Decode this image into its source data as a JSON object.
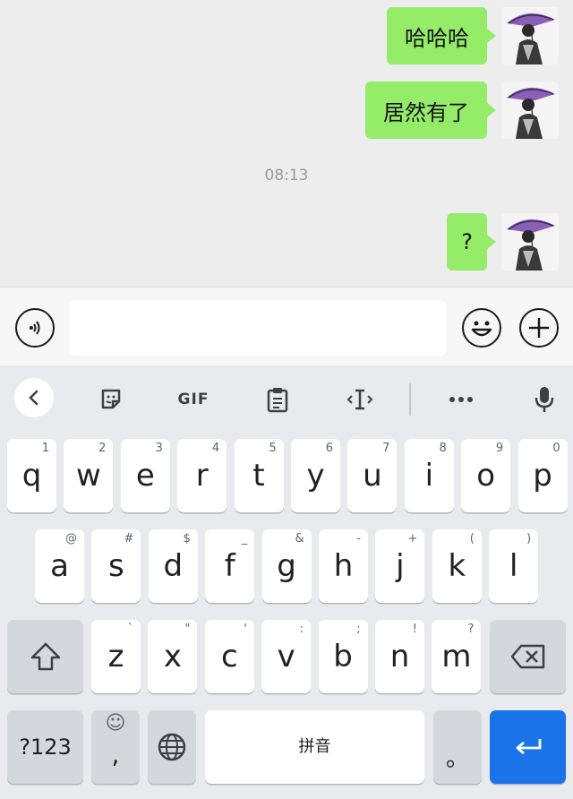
{
  "chat": {
    "messages": [
      {
        "text": "哈哈哈"
      },
      {
        "text": "居然有了"
      },
      {
        "text": "?"
      }
    ],
    "timestamp": "08:13"
  },
  "input": {
    "placeholder": ""
  },
  "keyboard": {
    "toolbar": {
      "gif_label": "GIF"
    },
    "row1": [
      {
        "key": "q",
        "hint": "1"
      },
      {
        "key": "w",
        "hint": "2"
      },
      {
        "key": "e",
        "hint": "3"
      },
      {
        "key": "r",
        "hint": "4"
      },
      {
        "key": "t",
        "hint": "5"
      },
      {
        "key": "y",
        "hint": "6"
      },
      {
        "key": "u",
        "hint": "7"
      },
      {
        "key": "i",
        "hint": "8"
      },
      {
        "key": "o",
        "hint": "9"
      },
      {
        "key": "p",
        "hint": "0"
      }
    ],
    "row2": [
      {
        "key": "a",
        "hint": "@"
      },
      {
        "key": "s",
        "hint": "#"
      },
      {
        "key": "d",
        "hint": "$"
      },
      {
        "key": "f",
        "hint": "_"
      },
      {
        "key": "g",
        "hint": "&"
      },
      {
        "key": "h",
        "hint": "-"
      },
      {
        "key": "j",
        "hint": "+"
      },
      {
        "key": "k",
        "hint": "("
      },
      {
        "key": "l",
        "hint": ")"
      }
    ],
    "row3": [
      {
        "key": "z",
        "hint": "`"
      },
      {
        "key": "x",
        "hint": "\""
      },
      {
        "key": "c",
        "hint": "'"
      },
      {
        "key": "v",
        "hint": ":"
      },
      {
        "key": "b",
        "hint": ";"
      },
      {
        "key": "n",
        "hint": "!"
      },
      {
        "key": "m",
        "hint": "?"
      }
    ],
    "symbols_label": "?123",
    "comma_label": ",",
    "comma_hint": "☺",
    "space_label": "拼音",
    "period_label": "。"
  },
  "colors": {
    "bubble": "#95ec69",
    "enter_key": "#1a73e8"
  }
}
